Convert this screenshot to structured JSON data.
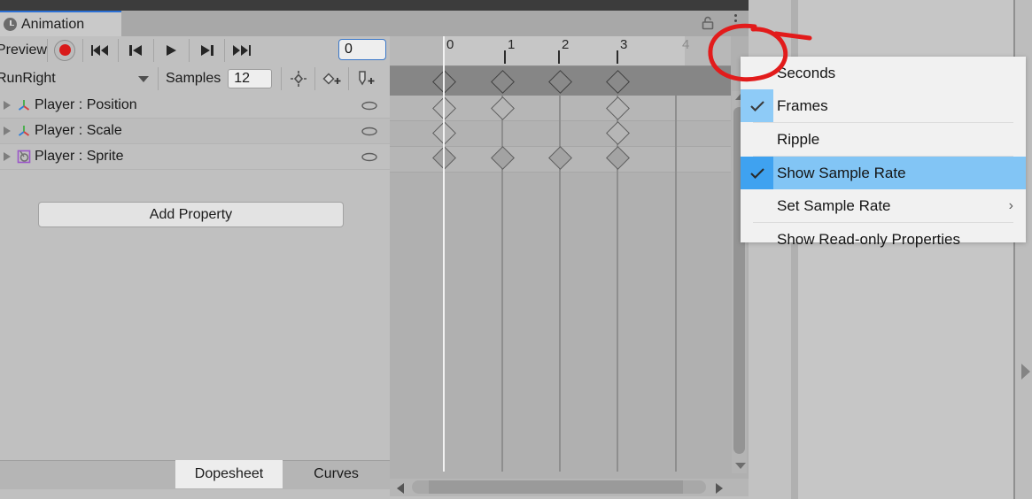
{
  "window": {
    "tab_label": "Animation",
    "tab_icon": "clock-icon",
    "lock_icon": "lock-open-icon",
    "menu_icon": "kebab-menu-icon"
  },
  "toolbar": {
    "preview_label": "Preview",
    "record_label": "record-button",
    "first_frame_label": "first-keyframe-button",
    "prev_frame_label": "previous-frame-button",
    "play_label": "play-button",
    "next_frame_label": "next-frame-button",
    "last_frame_label": "last-keyframe-button",
    "frame_field_value": "0",
    "clip_name": "RunRight",
    "samples_label": "Samples",
    "samples_value": "12",
    "add_keyframe_icon": "add-keyframe-icon",
    "add_property_keyframe_icon": "add-keyframe-diamond-icon",
    "add_event_icon": "add-event-icon"
  },
  "properties": {
    "rows": [
      {
        "label": "Player : Position",
        "icon": "transform-axis-icon"
      },
      {
        "label": "Player : Scale",
        "icon": "transform-axis-icon"
      },
      {
        "label": "Player : Sprite",
        "icon": "sprite-renderer-icon"
      }
    ],
    "add_property_label": "Add Property"
  },
  "bottom_tabs": {
    "dopesheet": "Dopesheet",
    "curves": "Curves",
    "active": "Dopesheet"
  },
  "timeline": {
    "tick_labels": [
      "0",
      "1",
      "2",
      "3",
      "4"
    ],
    "dim_tick_index": 4,
    "playhead_frame": "0",
    "keyframes": {
      "summary": [
        0,
        1,
        2,
        3
      ],
      "position": [
        0,
        1,
        3
      ],
      "scale": [
        0,
        3
      ],
      "sprite": [
        0,
        1,
        2,
        3
      ]
    }
  },
  "context_menu": {
    "items": [
      {
        "label": "Seconds",
        "checked": false,
        "highlighted": false,
        "submenu": false
      },
      {
        "label": "Frames",
        "checked": true,
        "highlighted": false,
        "submenu": false
      },
      {
        "label": "Ripple",
        "checked": false,
        "highlighted": false,
        "submenu": false
      },
      {
        "label": "Show Sample Rate",
        "checked": true,
        "highlighted": true,
        "submenu": false
      },
      {
        "label": "Set Sample Rate",
        "checked": false,
        "highlighted": false,
        "submenu": true,
        "submenu_glyph": "›"
      },
      {
        "label": "Show Read-only Properties",
        "checked": false,
        "highlighted": false,
        "submenu": false
      }
    ]
  },
  "annotation": {
    "shape": "red-circle-highlight",
    "color": "#e21b1b",
    "target": "kebab-menu-icon"
  },
  "colors": {
    "accent_blue": "#3b78c8",
    "menu_highlight": "#82c5f5",
    "record_red": "#d91b1b",
    "annotation_red": "#e21b1b",
    "panel_bg": "#c0c0c0"
  }
}
